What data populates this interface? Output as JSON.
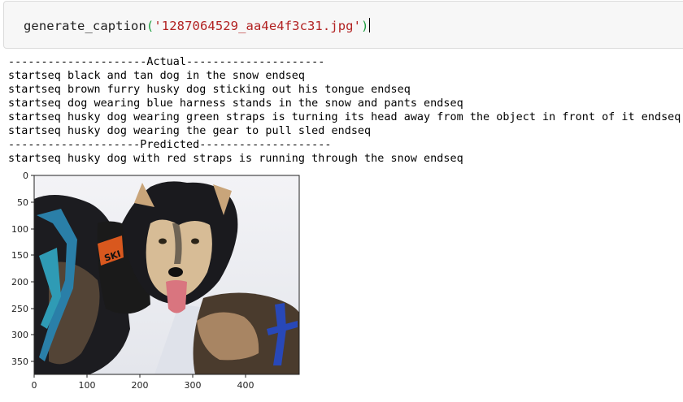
{
  "input": {
    "func": "generate_caption",
    "open_paren": "(",
    "arg": "'1287064529_aa4e4f3c31.jpg'",
    "close_paren": ")"
  },
  "output": {
    "actual_header": "---------------------Actual---------------------",
    "actual": [
      "startseq black and tan dog in the snow endseq",
      "startseq brown furry husky dog sticking out his tongue endseq",
      "startseq dog wearing blue harness stands in the snow and pants endseq",
      "startseq husky dog wearing green straps is turning its head away from the object in front of it endseq",
      "startseq husky dog wearing the gear to pull sled endseq"
    ],
    "predicted_header": "--------------------Predicted--------------------",
    "predicted": "startseq husky dog with red straps is running through the snow endseq"
  },
  "image": {
    "y_ticks": [
      "0",
      "50",
      "100",
      "150",
      "200",
      "250",
      "300",
      "350"
    ],
    "x_ticks": [
      "0",
      "100",
      "200",
      "300",
      "400"
    ],
    "harness_text": "SKI",
    "colors": {
      "snow": "#eceef3",
      "fur_dark": "#1a1a1e",
      "fur_tan": "#c9a57a",
      "harness_blue": "#2a7fa8",
      "strap_blue": "#2848b8",
      "tongue": "#d9757f"
    }
  }
}
